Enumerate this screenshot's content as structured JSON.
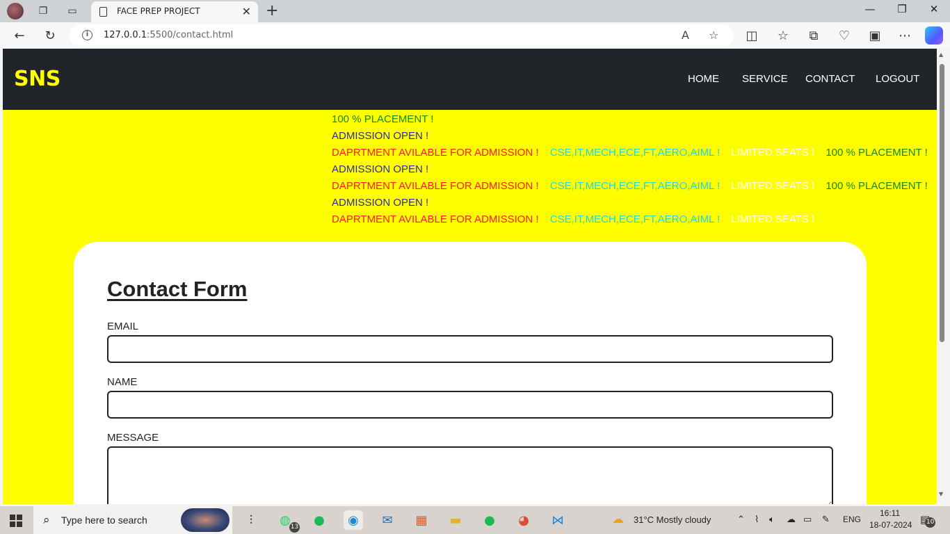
{
  "browser": {
    "tab_title": "FACE PREP PROJECT",
    "url_host": "127.0.0.1",
    "url_rest": ":5500/contact.html"
  },
  "navbar": {
    "brand": "SNS",
    "links": [
      "HOME",
      "SERVICE",
      "CONTACT",
      "LOGOUT"
    ]
  },
  "marquee": {
    "placement": "100 % PLACEMENT !",
    "admission": "ADMISSION OPEN !",
    "department": "DAPRTMENT AVILABLE FOR ADMISSION !",
    "courses": "CSE,IT,MECH,ECE,FT,AERO,AIML !",
    "seats": "LIMITED SEATS !"
  },
  "form": {
    "title": "Contact Form",
    "email_label": "EMAIL",
    "email_value": "",
    "name_label": "NAME",
    "name_value": "",
    "message_label": "MESSAGE",
    "message_value": ""
  },
  "taskbar": {
    "search_placeholder": "Type here to search",
    "whatsapp_badge": "13",
    "weather": "31°C  Mostly cloudy",
    "lang": "ENG",
    "time": "16:11",
    "date": "18-07-2024",
    "notifications": "10"
  },
  "colors": {
    "page_bg": "#ffff00",
    "navbar_bg": "#212529",
    "brand": "#ffff00"
  }
}
